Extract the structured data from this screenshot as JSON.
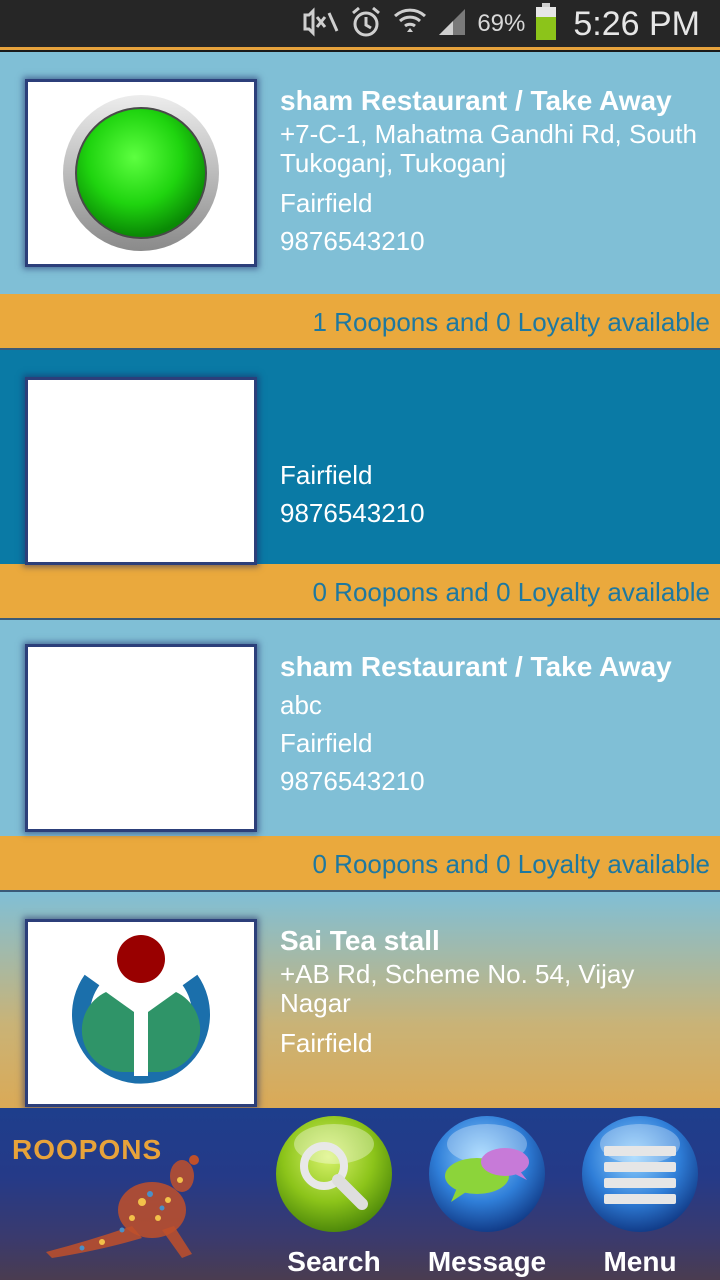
{
  "status_bar": {
    "battery_percent": "69%",
    "time": "5:26 PM",
    "icons": [
      "mute-icon",
      "alarm-icon",
      "wifi-icon",
      "signal-icon",
      "battery-icon"
    ]
  },
  "listings": [
    {
      "name": "sham Restaurant / Take Away",
      "address": "+7-C-1, Mahatma Gandhi Rd, South Tukoganj, Tukoganj",
      "city": "Fairfield",
      "phone": "9876543210",
      "offers": "1 Roopons and 0 Loyalty available",
      "image": "green-button-icon"
    },
    {
      "name": "",
      "address": "",
      "city": "Fairfield",
      "phone": "9876543210",
      "offers": "0 Roopons and 0 Loyalty available",
      "image": "blank"
    },
    {
      "name": "sham Restaurant / Take Away",
      "address": "abc",
      "city": "Fairfield",
      "phone": "9876543210",
      "offers": "0 Roopons and 0 Loyalty available",
      "image": "blank"
    },
    {
      "name": "Sai Tea stall",
      "address": "+AB Rd, Scheme No. 54, Vijay Nagar",
      "city": "Fairfield",
      "image": "wikimedia-logo"
    }
  ],
  "bottom_nav": {
    "logo_text": "ROOPONS",
    "search_label": "Search",
    "message_label": "Message",
    "menu_label": "Menu"
  },
  "colors": {
    "light_card": "#80bfd6",
    "dark_card": "#0a7aa5",
    "offer_bar": "#eaa93d",
    "offer_text": "#1e78a0"
  }
}
